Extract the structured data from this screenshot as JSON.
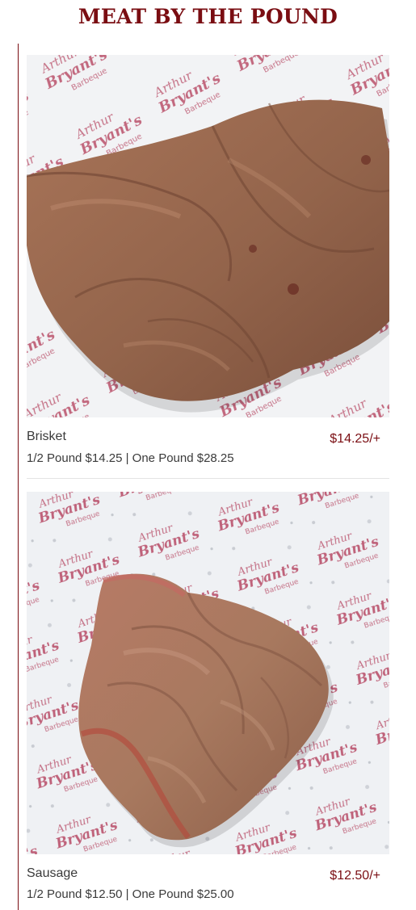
{
  "section": {
    "title": "MEAT BY THE POUND"
  },
  "photo_watermark": {
    "brand": "Arthur Bryant's",
    "sub": "Barbeque",
    "color": "#b23a57"
  },
  "items": [
    {
      "name": "Brisket",
      "price": "$14.25/+",
      "description": "1/2 Pound $14.25 | One Pound $28.25",
      "photo_icon": "sliced-brisket-photo"
    },
    {
      "name": "Sausage",
      "price": "$12.50/+",
      "description": "1/2 Pound $12.50 | One Pound $25.00",
      "photo_icon": "sliced-meat-photo"
    }
  ],
  "colors": {
    "accent": "#7a0d12",
    "text": "#3a3a3a",
    "meat": "#9a6a4f",
    "paper": "#f2f3f5"
  }
}
